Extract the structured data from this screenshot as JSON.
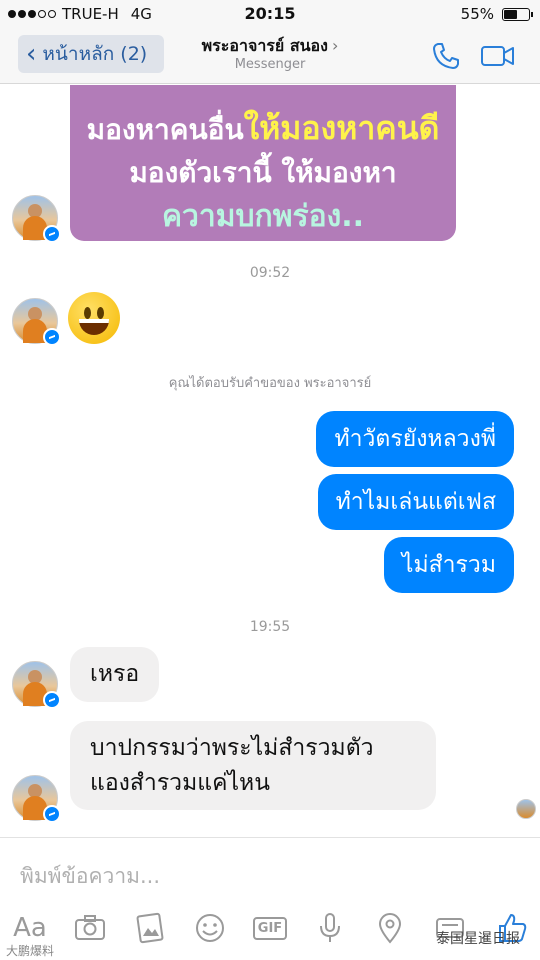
{
  "status_bar": {
    "carrier": "TRUE-H",
    "network": "4G",
    "time": "20:15",
    "battery": "55%",
    "battery_level": 0.55
  },
  "nav": {
    "back_label": "หน้าหลัก (2)",
    "title": "พระอาจารย์ สนอง",
    "title_chevron": "›",
    "subtitle": "Messenger",
    "accent_color": "#2a5d9f"
  },
  "image_card": {
    "line1_plain": "มองหาคนอื่น",
    "line1_highlight": "ให้มองหาคนดี",
    "line2": "มองตัวเรานี้ ให้มองหา",
    "line3": "ความบกพร่อง.."
  },
  "timestamps": {
    "first": "09:52",
    "second": "19:55"
  },
  "system_note": "คุณได้ตอบรับคำขอของ พระอาจารย์",
  "outgoing_messages": [
    "ทำวัตรยังหลวงพี่",
    "ทำไมเล่นแต่เฟส",
    "ไม่สำรวม"
  ],
  "incoming_messages": [
    "เหรอ",
    "บาปกรรมว่าพระไม่สำรวมตัว แองสำรวมแค่ไหน"
  ],
  "colors": {
    "outgoing_bubble": "#0084ff",
    "incoming_bubble": "#f1f0f0",
    "image_card_bg": "#b27cb8"
  },
  "composer": {
    "placeholder": "พิมพ์ข้อความ...",
    "aa_label": "Aa",
    "gif_label": "GIF",
    "icons": [
      "aa-icon",
      "camera-icon",
      "gallery-icon",
      "sticker-icon",
      "gif-icon",
      "microphone-icon",
      "location-icon",
      "apps-icon",
      "like-icon"
    ]
  },
  "watermarks": {
    "left": "大鹏爆料",
    "right": "泰国星暹日报"
  }
}
